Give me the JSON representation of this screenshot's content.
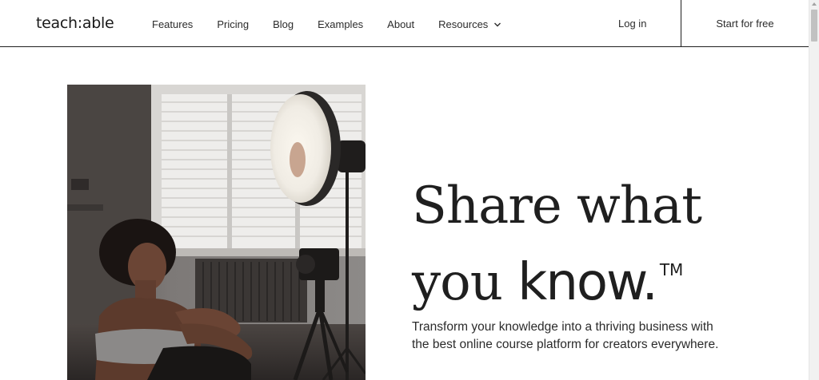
{
  "header": {
    "logo": "teach:able",
    "nav": [
      {
        "label": "Features"
      },
      {
        "label": "Pricing"
      },
      {
        "label": "Blog"
      },
      {
        "label": "Examples"
      },
      {
        "label": "About"
      },
      {
        "label": "Resources"
      }
    ],
    "login_label": "Log in",
    "start_label": "Start for free"
  },
  "hero": {
    "headline_line1": "Share what",
    "headline_line2_regular": "you ",
    "headline_line2_bold": "know.",
    "trademark": "TM",
    "subtext": "Transform your knowledge into a thriving business with the best online course platform for creators everywhere."
  }
}
